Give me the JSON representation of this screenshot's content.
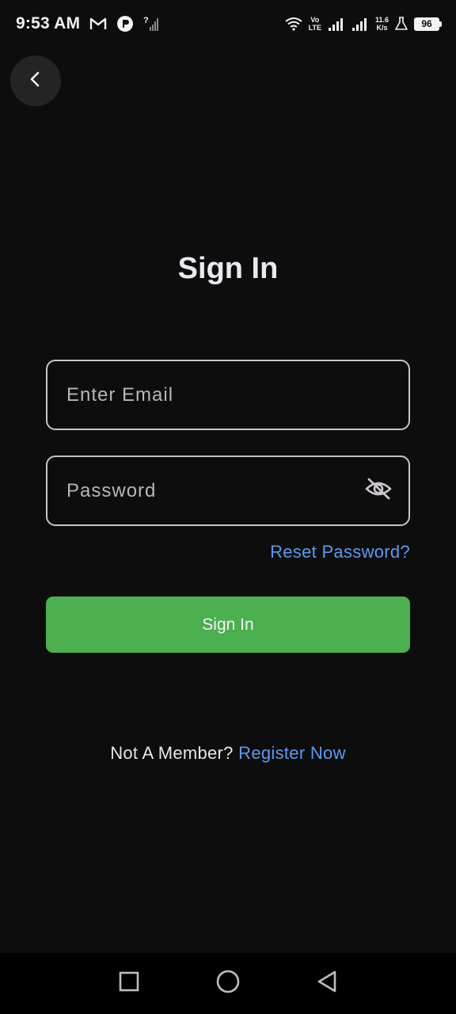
{
  "status_bar": {
    "time": "9:53 AM",
    "icons": [
      "gmail-icon",
      "app-notification-icon",
      "no-sim-signal-icon",
      "wifi-icon",
      "volte-icon",
      "signal-icon",
      "signal-icon",
      "network-speed",
      "lab-icon",
      "battery-icon"
    ],
    "volte_top": "Vo",
    "volte_bottom": "LTE",
    "netspeed_value": "11.6",
    "netspeed_unit": "K/s",
    "battery_level": "96"
  },
  "header": {
    "back_icon": "chevron-left-icon"
  },
  "page": {
    "title": "Sign In"
  },
  "form": {
    "email_placeholder": "Enter Email",
    "email_value": "",
    "password_placeholder": "Password",
    "password_value": "",
    "password_toggle_icon": "eye-off-icon",
    "reset_label": "Reset Password?",
    "submit_label": "Sign In"
  },
  "footer": {
    "prompt": "Not A Member?",
    "register_label": "Register Now"
  },
  "nav_bar": {
    "recents_icon": "square-icon",
    "home_icon": "circle-icon",
    "back_icon": "triangle-back-icon"
  },
  "colors": {
    "background": "#0d0d0d",
    "accent_green": "#4caf50",
    "link_blue": "#5b9bf0",
    "field_border": "#c9c4cc"
  }
}
